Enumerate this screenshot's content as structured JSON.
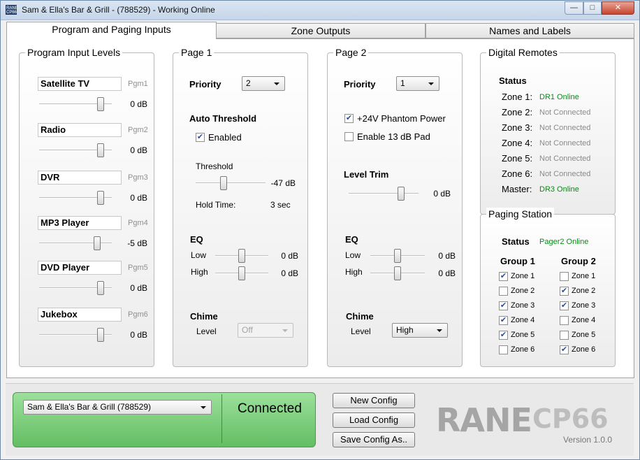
{
  "window": {
    "icon_text": "RANE CP66",
    "title": "Sam & Ella's Bar & Grill - (788529) - Working Online",
    "minimize_glyph": "—",
    "maximize_glyph": "□",
    "close_glyph": "✕"
  },
  "tabs": [
    {
      "label": "Program and Paging Inputs",
      "active": true
    },
    {
      "label": "Zone Outputs",
      "active": false
    },
    {
      "label": "Names and Labels",
      "active": false
    }
  ],
  "program_inputs": {
    "title": "Program Input Levels",
    "items": [
      {
        "name": "Satellite TV",
        "tag": "Pgm1",
        "level": "0 dB",
        "fader": 0.85
      },
      {
        "name": "Radio",
        "tag": "Pgm2",
        "level": "0 dB",
        "fader": 0.85
      },
      {
        "name": "DVR",
        "tag": "Pgm3",
        "level": "0 dB",
        "fader": 0.85
      },
      {
        "name": "MP3 Player",
        "tag": "Pgm4",
        "level": "-5 dB",
        "fader": 0.8
      },
      {
        "name": "DVD Player",
        "tag": "Pgm5",
        "level": "0 dB",
        "fader": 0.85
      },
      {
        "name": "Jukebox",
        "tag": "Pgm6",
        "level": "0 dB",
        "fader": 0.85
      }
    ]
  },
  "page1": {
    "title": "Page 1",
    "priority_label": "Priority",
    "priority_value": "2",
    "auto_threshold_label": "Auto Threshold",
    "enabled_label": "Enabled",
    "enabled_checked": true,
    "threshold_label": "Threshold",
    "threshold_value": "-47 dB",
    "threshold_fader": 0.4,
    "hold_time_label": "Hold Time:",
    "hold_time_value": "3 sec",
    "eq_label": "EQ",
    "low_label": "Low",
    "low_value": "0 dB",
    "low_fader": 0.5,
    "high_label": "High",
    "high_value": "0 dB",
    "high_fader": 0.5,
    "chime_label": "Chime",
    "chime_level_label": "Level",
    "chime_level_value": "Off"
  },
  "page2": {
    "title": "Page 2",
    "priority_label": "Priority",
    "priority_value": "1",
    "phantom_label": "+24V Phantom Power",
    "phantom_checked": true,
    "pad_label": "Enable 13 dB Pad",
    "pad_checked": false,
    "level_trim_label": "Level Trim",
    "level_trim_value": "0 dB",
    "level_trim_fader": 0.75,
    "eq_label": "EQ",
    "low_label": "Low",
    "low_value": "0 dB",
    "low_fader": 0.5,
    "high_label": "High",
    "high_value": "0 dB",
    "high_fader": 0.5,
    "chime_label": "Chime",
    "chime_level_label": "Level",
    "chime_level_value": "High"
  },
  "digital_remotes": {
    "title": "Digital Remotes",
    "status_label": "Status",
    "rows": [
      {
        "label": "Zone 1:",
        "value": "DR1 Online",
        "online": true
      },
      {
        "label": "Zone 2:",
        "value": "Not Connected",
        "online": false
      },
      {
        "label": "Zone 3:",
        "value": "Not Connected",
        "online": false
      },
      {
        "label": "Zone 4:",
        "value": "Not Connected",
        "online": false
      },
      {
        "label": "Zone 5:",
        "value": "Not Connected",
        "online": false
      },
      {
        "label": "Zone 6:",
        "value": "Not Connected",
        "online": false
      },
      {
        "label": "Master:",
        "value": "DR3 Online",
        "online": true
      }
    ]
  },
  "paging_station": {
    "title": "Paging Station",
    "status_label": "Status",
    "status_value": "Pager2 Online",
    "group1_label": "Group 1",
    "group2_label": "Group 2",
    "group1": [
      {
        "label": "Zone 1",
        "checked": true
      },
      {
        "label": "Zone 2",
        "checked": false
      },
      {
        "label": "Zone 3",
        "checked": true
      },
      {
        "label": "Zone 4",
        "checked": true
      },
      {
        "label": "Zone 5",
        "checked": true
      },
      {
        "label": "Zone 6",
        "checked": false
      }
    ],
    "group2": [
      {
        "label": "Zone 1",
        "checked": false
      },
      {
        "label": "Zone 2",
        "checked": true
      },
      {
        "label": "Zone 3",
        "checked": true
      },
      {
        "label": "Zone 4",
        "checked": false
      },
      {
        "label": "Zone 5",
        "checked": false
      },
      {
        "label": "Zone 6",
        "checked": true
      }
    ]
  },
  "footer": {
    "device_select": "Sam & Ella's Bar & Grill (788529)",
    "connection_status": "Connected",
    "new_config": "New Config",
    "load_config": "Load Config",
    "save_config": "Save Config As..",
    "brand": "RANE",
    "model": "CP66",
    "version": "Version 1.0.0"
  },
  "colors": {
    "online": "#0a8a18",
    "connected_panel": "#7fd07f"
  }
}
